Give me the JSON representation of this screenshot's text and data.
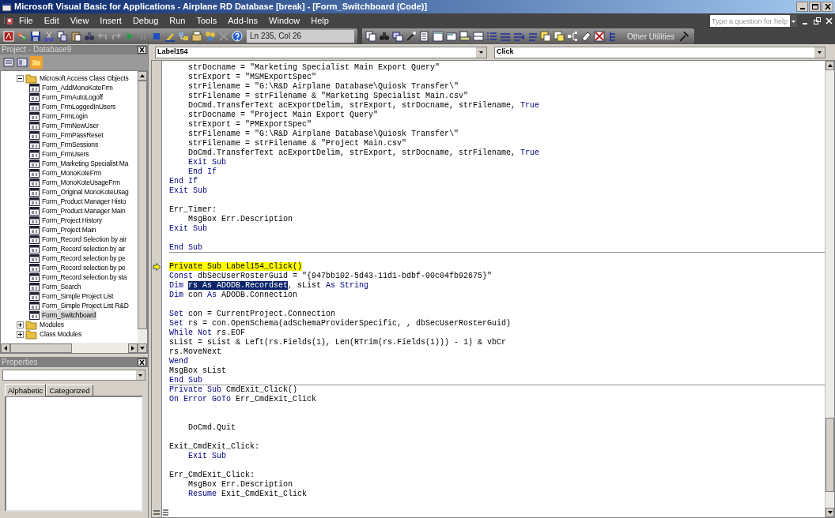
{
  "window": {
    "title": "Microsoft Visual Basic for Applications - Airplane RD Database [break] - [Form_Switchboard (Code)]"
  },
  "menu": [
    "File",
    "Edit",
    "View",
    "Insert",
    "Debug",
    "Run",
    "Tools",
    "Add-Ins",
    "Window",
    "Help"
  ],
  "help_box": {
    "placeholder": "Type a question for help"
  },
  "toolbar": {
    "position": "Ln 235, Col 26",
    "other_utilities": "Other Utilities"
  },
  "project": {
    "title": "Project - Database9",
    "tree": [
      {
        "label": "Microsoft Access Class Objects",
        "kind": "folder",
        "expanded": true,
        "children": [
          {
            "label": "Form_AddMonoKoteFrm",
            "kind": "form",
            "selected": false
          },
          {
            "label": "Form_FrmAutoLogoff",
            "kind": "form",
            "selected": false
          },
          {
            "label": "Form_FrmLoggedInUsers",
            "kind": "form",
            "selected": false
          },
          {
            "label": "Form_FrmLogin",
            "kind": "form",
            "selected": false
          },
          {
            "label": "Form_FrmNewUser",
            "kind": "form",
            "selected": false
          },
          {
            "label": "Form_FrmPassReset",
            "kind": "form",
            "selected": false
          },
          {
            "label": "Form_FrmSessions",
            "kind": "form",
            "selected": false
          },
          {
            "label": "Form_FrmUsers",
            "kind": "form",
            "selected": false
          },
          {
            "label": "Form_Marketing Specialist Ma",
            "kind": "form",
            "selected": false
          },
          {
            "label": "Form_MonoKoteFrm",
            "kind": "form",
            "selected": false
          },
          {
            "label": "Form_MonoKoteUsageFrm",
            "kind": "form",
            "selected": false
          },
          {
            "label": "Form_Original MonoKoteUsag",
            "kind": "form",
            "selected": false
          },
          {
            "label": "Form_Product Manager Histo",
            "kind": "form",
            "selected": false
          },
          {
            "label": "Form_Product Manager Main",
            "kind": "form",
            "selected": false
          },
          {
            "label": "Form_Project History",
            "kind": "form",
            "selected": false
          },
          {
            "label": "Form_Project Main",
            "kind": "form",
            "selected": false
          },
          {
            "label": "Form_Record Selection by air",
            "kind": "form",
            "selected": false
          },
          {
            "label": "Form_Record selection by air",
            "kind": "form",
            "selected": false
          },
          {
            "label": "Form_Record selection by pe",
            "kind": "form",
            "selected": false
          },
          {
            "label": "Form_Record selection by pe",
            "kind": "form",
            "selected": false
          },
          {
            "label": "Form_Record selection by sta",
            "kind": "form",
            "selected": false
          },
          {
            "label": "Form_Search",
            "kind": "form",
            "selected": false
          },
          {
            "label": "Form_Simple Project List",
            "kind": "form",
            "selected": false
          },
          {
            "label": "Form_Simple Project List R&D",
            "kind": "form",
            "selected": false
          },
          {
            "label": "Form_Switchboard",
            "kind": "form",
            "selected": true
          }
        ]
      },
      {
        "label": "Modules",
        "kind": "folder",
        "expanded": false
      },
      {
        "label": "Class Modules",
        "kind": "folder",
        "expanded": false
      }
    ]
  },
  "properties": {
    "title": "Properties",
    "tabs": [
      {
        "label": "Alphabetic",
        "selected": true
      },
      {
        "label": "Categorized",
        "selected": false
      }
    ]
  },
  "code": {
    "object": "Label154",
    "procedure": "Click",
    "procedures": [
      {
        "lines": [
          {
            "kind": "code",
            "text": "    strDocname = \"Marketing Specialist Main Export Query\""
          },
          {
            "kind": "code",
            "text": "    strExport = \"MSMExportSpec\""
          },
          {
            "kind": "code",
            "text": "    strFilename = \"G:\\R&D Airplane Database\\Quiosk Transfer\\\""
          },
          {
            "kind": "code",
            "text": "    strFilename = strFilename & \"Marketing Specialist Main.csv\""
          },
          {
            "kind": "code",
            "segments": [
              {
                "kind": "code",
                "text": "    DoCmd.TransferText acExportDelim, strExport, strDocname, strFilename, "
              },
              {
                "kind": "keyword",
                "text": "True"
              }
            ]
          },
          {
            "kind": "code",
            "text": "    strDocname = \"Project Main Export Query\""
          },
          {
            "kind": "code",
            "text": "    strExport = \"PMExportSpec\""
          },
          {
            "kind": "code",
            "text": "    strFilename = \"G:\\R&D Airplane Database\\Quiosk Transfer\\\""
          },
          {
            "kind": "code",
            "text": "    strFilename = strFilename & \"Project Main.csv\""
          },
          {
            "kind": "code",
            "segments": [
              {
                "kind": "code",
                "text": "    DoCmd.TransferText acExportDelim, strExport, strDocname, strFilename, "
              },
              {
                "kind": "keyword",
                "text": "True"
              }
            ]
          },
          {
            "kind": "code",
            "segments": [
              {
                "kind": "keyword",
                "text": "    Exit Sub"
              }
            ]
          },
          {
            "kind": "code",
            "segments": [
              {
                "kind": "keyword",
                "text": "    End If"
              }
            ]
          },
          {
            "kind": "code",
            "segments": [
              {
                "kind": "keyword",
                "text": "End If"
              }
            ]
          },
          {
            "kind": "code",
            "segments": [
              {
                "kind": "keyword",
                "text": "Exit Sub"
              }
            ]
          },
          {
            "kind": "blank"
          },
          {
            "kind": "code",
            "text": "Err_Timer:"
          },
          {
            "kind": "code",
            "text": "    MsgBox Err.Description"
          },
          {
            "kind": "code",
            "segments": [
              {
                "kind": "keyword",
                "text": "Exit Sub"
              }
            ]
          },
          {
            "kind": "blank"
          },
          {
            "kind": "code",
            "segments": [
              {
                "kind": "keyword",
                "text": "End Sub"
              }
            ]
          }
        ]
      },
      {
        "lines": [
          {
            "kind": "blank"
          },
          {
            "kind": "code",
            "segments": [
              {
                "kind": "current",
                "text": "Private Sub Label154_Click()"
              }
            ]
          },
          {
            "kind": "code",
            "segments": [
              {
                "kind": "keyword",
                "text": "Const"
              },
              {
                "kind": "code",
                "text": " dbSecUserRosterGuid = \"{947bb102-5d43-11d1-bdbf-00c04fb92675}\""
              }
            ]
          },
          {
            "kind": "code",
            "segments": [
              {
                "kind": "keyword",
                "text": "Dim "
              },
              {
                "kind": "selected",
                "text": "rs As ADODB.Recordset"
              },
              {
                "kind": "code",
                "text": ", sList "
              },
              {
                "kind": "keyword",
                "text": "As String"
              }
            ]
          },
          {
            "kind": "code",
            "segments": [
              {
                "kind": "keyword",
                "text": "Dim"
              },
              {
                "kind": "code",
                "text": " con "
              },
              {
                "kind": "keyword",
                "text": "As"
              },
              {
                "kind": "code",
                "text": " ADODB.Connection"
              }
            ]
          },
          {
            "kind": "blank"
          },
          {
            "kind": "code",
            "segments": [
              {
                "kind": "keyword",
                "text": "Set"
              },
              {
                "kind": "code",
                "text": " con = CurrentProject.Connection"
              }
            ]
          },
          {
            "kind": "code",
            "segments": [
              {
                "kind": "keyword",
                "text": "Set"
              },
              {
                "kind": "code",
                "text": " rs = con.OpenSchema(adSchemaProviderSpecific, , dbSecUserRosterGuid)"
              }
            ]
          },
          {
            "kind": "code",
            "segments": [
              {
                "kind": "keyword",
                "text": "While Not"
              },
              {
                "kind": "code",
                "text": " rs.EOF"
              }
            ]
          },
          {
            "kind": "code",
            "text": "sList = sList & Left(rs.Fields(1), Len(RTrim(rs.Fields(1))) - 1) & vbCr"
          },
          {
            "kind": "code",
            "text": "rs.MoveNext"
          },
          {
            "kind": "code",
            "segments": [
              {
                "kind": "keyword",
                "text": "Wend"
              }
            ]
          },
          {
            "kind": "code",
            "text": "MsgBox sList"
          },
          {
            "kind": "code",
            "segments": [
              {
                "kind": "keyword",
                "text": "End Sub"
              }
            ]
          }
        ]
      },
      {
        "lines": [
          {
            "kind": "code",
            "segments": [
              {
                "kind": "keyword",
                "text": "Private Sub"
              },
              {
                "kind": "code",
                "text": " CmdExit_Click()"
              }
            ]
          },
          {
            "kind": "code",
            "segments": [
              {
                "kind": "keyword",
                "text": "On Error GoTo"
              },
              {
                "kind": "code",
                "text": " Err_CmdExit_Click"
              }
            ]
          },
          {
            "kind": "blank"
          },
          {
            "kind": "blank"
          },
          {
            "kind": "code",
            "text": "    DoCmd.Quit"
          },
          {
            "kind": "blank"
          },
          {
            "kind": "code",
            "text": "Exit_CmdExit_Click:"
          },
          {
            "kind": "code",
            "segments": [
              {
                "kind": "keyword",
                "text": "    Exit Sub"
              }
            ]
          },
          {
            "kind": "blank"
          },
          {
            "kind": "code",
            "text": "Err_CmdExit_Click:"
          },
          {
            "kind": "code",
            "text": "    MsgBox Err.Description"
          },
          {
            "kind": "code",
            "segments": [
              {
                "kind": "keyword",
                "text": "    Resume"
              },
              {
                "kind": "code",
                "text": " Exit_CmdExit_Click"
              }
            ]
          }
        ]
      }
    ]
  }
}
